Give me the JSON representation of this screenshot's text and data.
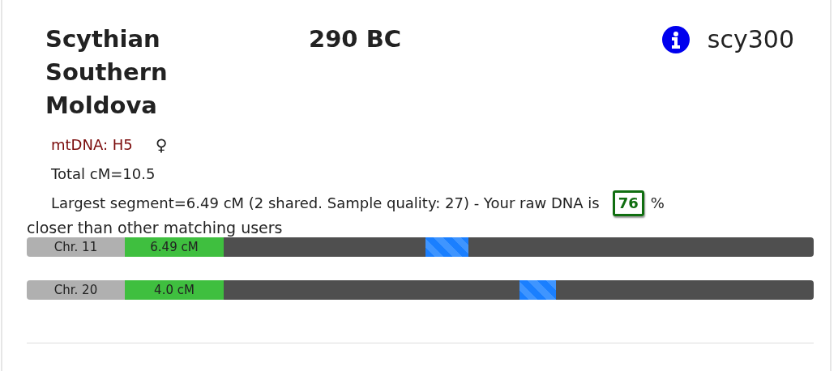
{
  "sample": {
    "name": "Scythian Southern Moldova",
    "date": "290 BC",
    "id": "scy300"
  },
  "mtdna": "mtDNA: H5",
  "sex_symbol": "♀",
  "total": "Total cM=10.5",
  "largest": "Largest segment=6.49 cM (2 shared. Sample quality: 27) - Your raw DNA is",
  "closeness_score": "76",
  "percent_sign": "%",
  "closeness_tail": "closer than other matching users",
  "chromosomes": [
    {
      "label": "Chr. 11",
      "cm": "6.49 cM"
    },
    {
      "label": "Chr. 20",
      "cm": "4.0 cM"
    }
  ]
}
